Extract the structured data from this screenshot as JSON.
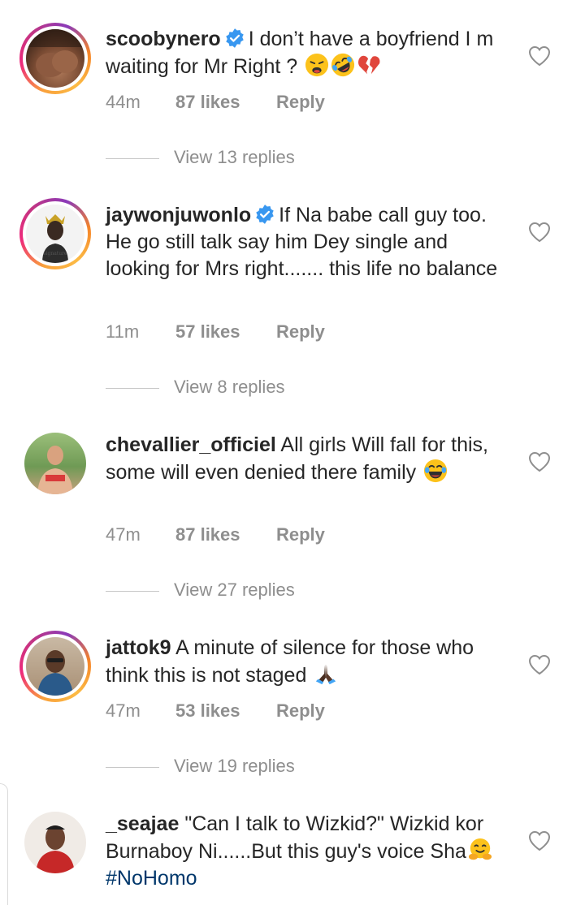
{
  "comments": [
    {
      "username": "scoobynero",
      "verified": true,
      "text_before_emoji": "I don’t have a boyfriend I m waiting for Mr Right ?",
      "emojis": [
        "weary-face",
        "rolling-on-floor-laughing",
        "broken-heart"
      ],
      "time": "44m",
      "likes": "87 likes",
      "reply": "Reply",
      "view_replies": "View 13 replies",
      "avatar_ring": true
    },
    {
      "username": "jaywonjuwonlo",
      "verified": true,
      "text": "If Na babe call guy too.  He go still talk say him Dey single and looking for Mrs right....... this life no balance",
      "time": "11m",
      "likes": "57 likes",
      "reply": "Reply",
      "view_replies": "View 8 replies",
      "avatar_ring": true
    },
    {
      "username": "chevallier_officiel",
      "verified": false,
      "text": "All girls Will fall for this, some will even denied there family",
      "emojis": [
        "face-with-tears-of-joy"
      ],
      "time": "47m",
      "likes": "87 likes",
      "reply": "Reply",
      "view_replies": "View 27 replies",
      "avatar_ring": false
    },
    {
      "username": "jattok9",
      "verified": false,
      "text": "A minute of silence for those who think this is not staged",
      "emojis": [
        "folded-hands"
      ],
      "time": "47m",
      "likes": "53 likes",
      "reply": "Reply",
      "view_replies": "View 19 replies",
      "avatar_ring": true
    },
    {
      "username": "_seajae",
      "verified": false,
      "text": "\"Can I talk to Wizkid?\" Wizkid kor Burnaboy Ni......But this guy's voice Sha",
      "emojis": [
        "hugging-face"
      ],
      "hashtag": "#NoHomo",
      "avatar_ring": false
    }
  ],
  "colors": {
    "text": "#262626",
    "meta": "#8e8e8e",
    "verified": "#3897f0",
    "hashtag": "#00376b"
  }
}
